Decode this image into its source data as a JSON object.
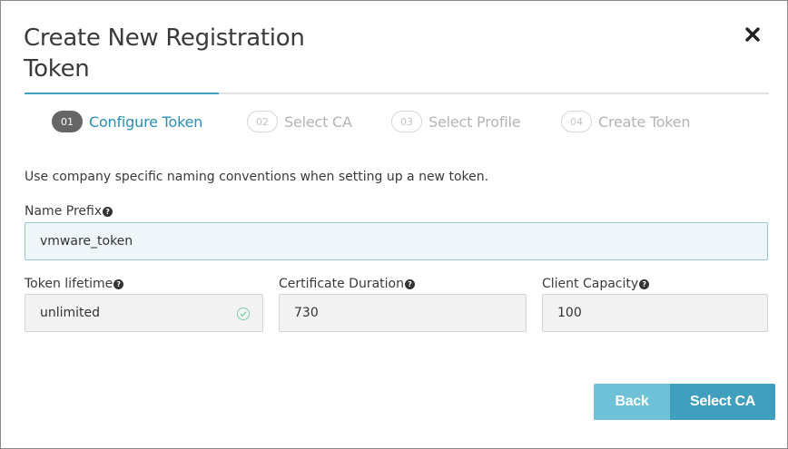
{
  "dialog": {
    "title": "Create New Registration Token",
    "close_icon": "close-icon"
  },
  "steps": [
    {
      "num": "01",
      "label": "Configure Token",
      "active": true
    },
    {
      "num": "02",
      "label": "Select CA",
      "active": false
    },
    {
      "num": "03",
      "label": "Select Profile",
      "active": false
    },
    {
      "num": "04",
      "label": "Create Token",
      "active": false
    }
  ],
  "helper_text": "Use company specific naming conventions when setting up a new token.",
  "fields": {
    "name_prefix": {
      "label": "Name Prefix",
      "value": "vmware_token"
    },
    "token_lifetime": {
      "label": "Token lifetime",
      "value": "unlimited"
    },
    "certificate_duration": {
      "label": "Certificate Duration",
      "value": "730"
    },
    "client_capacity": {
      "label": "Client Capacity",
      "value": "100"
    }
  },
  "buttons": {
    "back": "Back",
    "next": "Select CA"
  },
  "colors": {
    "accent": "#3da3bd",
    "active_step_text": "#2a8fb5",
    "back_button": "#6ec1d6",
    "next_button": "#3f9fbc",
    "valid_check": "#7fcfa8"
  }
}
